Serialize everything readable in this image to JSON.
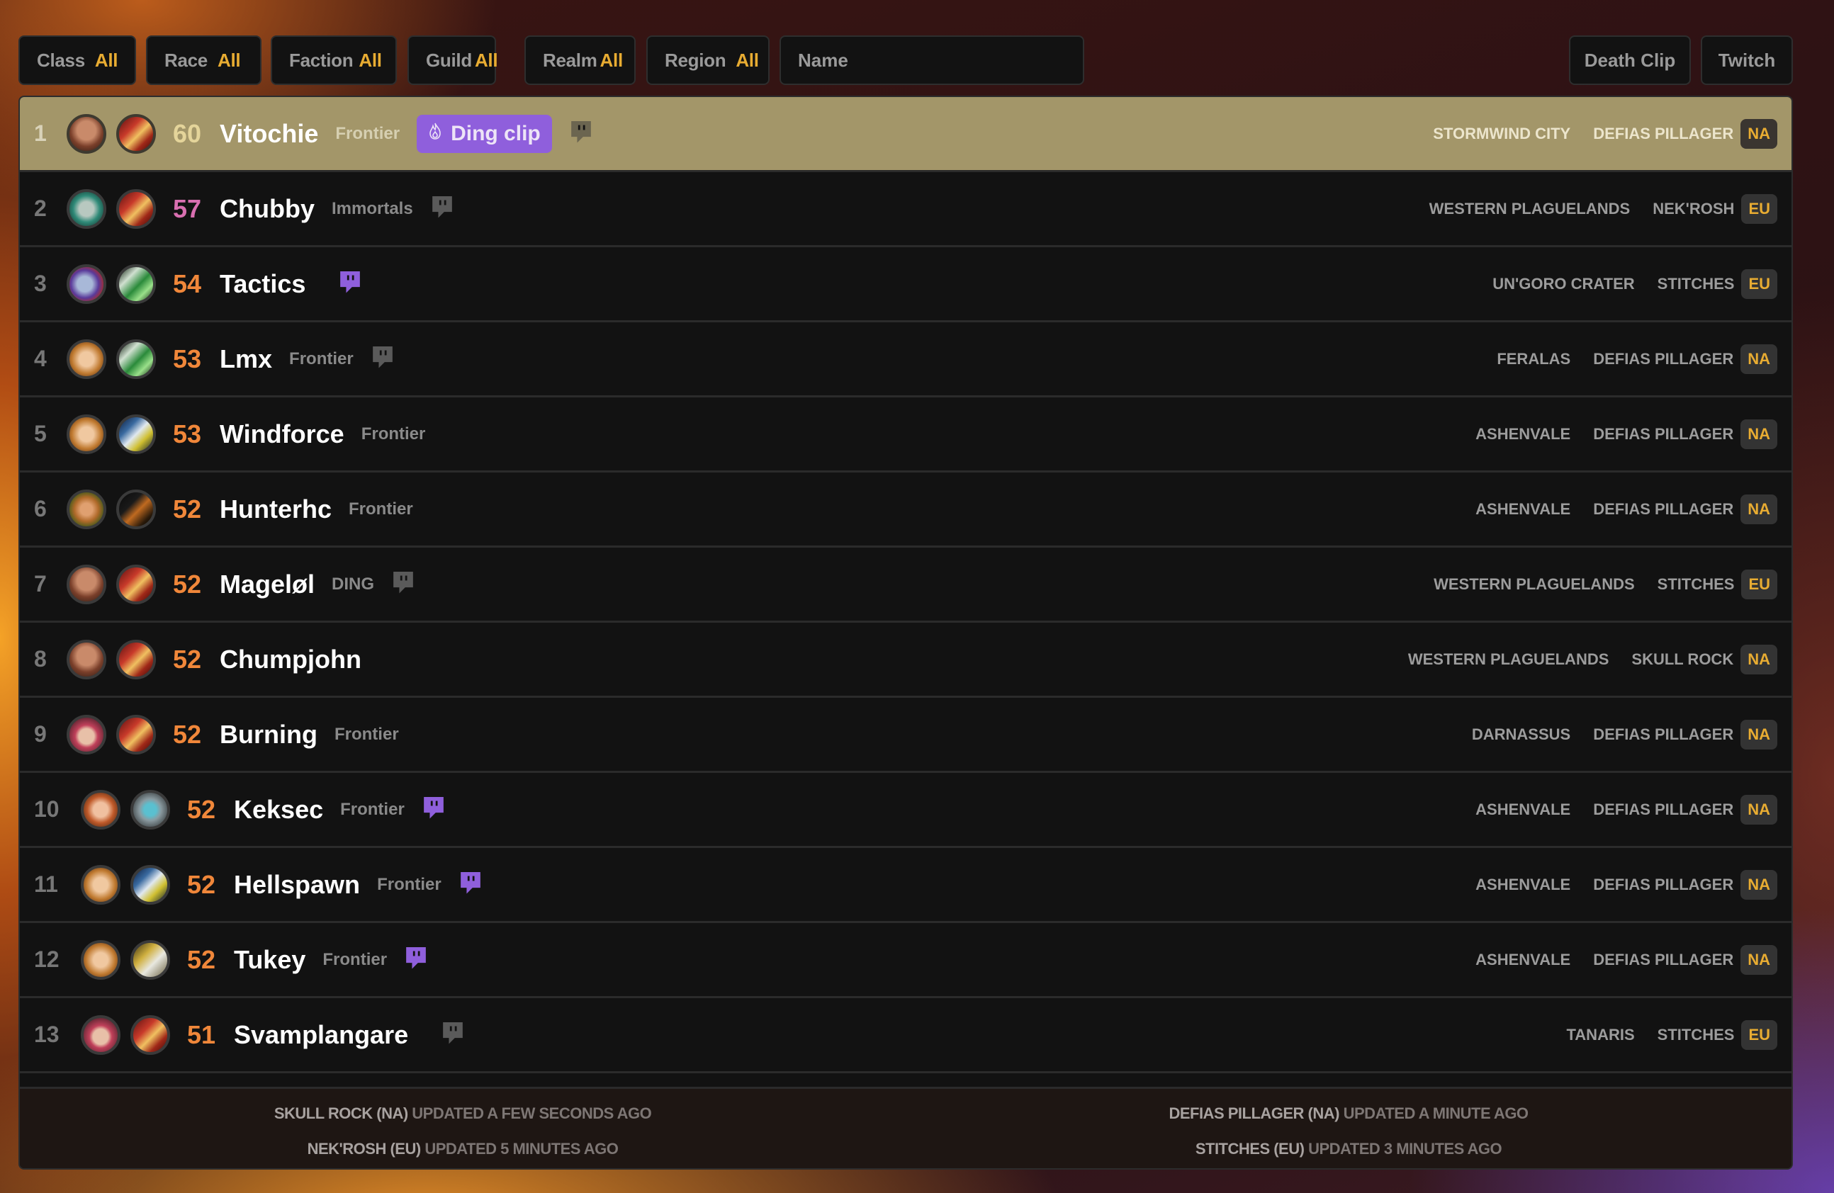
{
  "filters": [
    {
      "label": "Class",
      "value": "All"
    },
    {
      "label": "Race",
      "value": "All"
    },
    {
      "label": "Faction",
      "value": "All"
    },
    {
      "label": "Guild",
      "value": "All"
    },
    {
      "label": "Realm",
      "value": "All"
    },
    {
      "label": "Region",
      "value": "All"
    }
  ],
  "search": {
    "placeholder": "Name",
    "value": ""
  },
  "toolbar": {
    "death_clip_label": "Death Clip",
    "twitch_label": "Twitch"
  },
  "colors": {
    "accent": "#e8ac32",
    "highlight_row": "#a39669",
    "twitch_active": "#8f5fdc",
    "twitch_inactive": "#5a5a5a",
    "level_orange": "#f0873a",
    "level_pink": "#d86fb0",
    "level_gold": "#e4d49a"
  },
  "players": [
    {
      "rank": "1",
      "level": "60",
      "level_color": "level_gold",
      "name": "Vitochie",
      "guild": "Frontier",
      "ding_clip": "Ding clip",
      "twitch": "inactive",
      "zone": "STORMWIND CITY",
      "realm": "DEFIAS PILLAGER",
      "region": "NA",
      "race_icon": "gnome-male-portrait-icon",
      "class_icon": "mage-class-icon"
    },
    {
      "rank": "2",
      "level": "57",
      "level_color": "level_pink",
      "name": "Chubby",
      "guild": "Immortals",
      "twitch": "inactive",
      "zone": "WESTERN PLAGUELANDS",
      "realm": "NEK'ROSH",
      "region": "EU",
      "race_icon": "undead-female-portrait-icon",
      "class_icon": "mage-class-icon"
    },
    {
      "rank": "3",
      "level": "54",
      "level_color": "level_orange",
      "name": "Tactics",
      "guild": "",
      "twitch": "active",
      "zone": "UN'GORO CRATER",
      "realm": "STITCHES",
      "region": "EU",
      "race_icon": "troll-male-portrait-icon",
      "class_icon": "hunter-class-icon"
    },
    {
      "rank": "4",
      "level": "53",
      "level_color": "level_orange",
      "name": "Lmx",
      "guild": "Frontier",
      "twitch": "inactive",
      "zone": "FERALAS",
      "realm": "DEFIAS PILLAGER",
      "region": "NA",
      "race_icon": "human-female-portrait-icon",
      "class_icon": "hunter-class-icon"
    },
    {
      "rank": "5",
      "level": "53",
      "level_color": "level_orange",
      "name": "Windforce",
      "guild": "Frontier",
      "twitch": "none",
      "zone": "ASHENVALE",
      "realm": "DEFIAS PILLAGER",
      "region": "NA",
      "race_icon": "human-female-portrait-icon",
      "class_icon": "warrior-class-icon"
    },
    {
      "rank": "6",
      "level": "52",
      "level_color": "level_orange",
      "name": "Hunterhc",
      "guild": "Frontier",
      "twitch": "none",
      "zone": "ASHENVALE",
      "realm": "DEFIAS PILLAGER",
      "region": "NA",
      "race_icon": "dwarf-male-portrait-icon",
      "class_icon": "rogue-class-icon"
    },
    {
      "rank": "7",
      "level": "52",
      "level_color": "level_orange",
      "name": "Mageløl",
      "guild": "DING",
      "twitch": "inactive",
      "zone": "WESTERN PLAGUELANDS",
      "realm": "STITCHES",
      "region": "EU",
      "race_icon": "gnome-male-portrait-icon",
      "class_icon": "mage-class-icon"
    },
    {
      "rank": "8",
      "level": "52",
      "level_color": "level_orange",
      "name": "Chumpjohn",
      "guild": "",
      "twitch": "none",
      "zone": "WESTERN PLAGUELANDS",
      "realm": "SKULL ROCK",
      "region": "NA",
      "race_icon": "gnome-male-portrait-icon",
      "class_icon": "mage-class-icon"
    },
    {
      "rank": "9",
      "level": "52",
      "level_color": "level_orange",
      "name": "Burning",
      "guild": "Frontier",
      "twitch": "none",
      "zone": "DARNASSUS",
      "realm": "DEFIAS PILLAGER",
      "region": "NA",
      "race_icon": "gnome-female-portrait-icon",
      "class_icon": "mage-class-icon"
    },
    {
      "rank": "10",
      "level": "52",
      "level_color": "level_orange",
      "name": "Keksec",
      "guild": "Frontier",
      "twitch": "active",
      "zone": "ASHENVALE",
      "realm": "DEFIAS PILLAGER",
      "region": "NA",
      "race_icon": "dwarf-female-portrait-icon",
      "class_icon": "paladin-class-icon"
    },
    {
      "rank": "11",
      "level": "52",
      "level_color": "level_orange",
      "name": "Hellspawn",
      "guild": "Frontier",
      "twitch": "active",
      "zone": "ASHENVALE",
      "realm": "DEFIAS PILLAGER",
      "region": "NA",
      "race_icon": "human-female-portrait-icon",
      "class_icon": "warrior-class-icon"
    },
    {
      "rank": "12",
      "level": "52",
      "level_color": "level_orange",
      "name": "Tukey",
      "guild": "Frontier",
      "twitch": "active",
      "zone": "ASHENVALE",
      "realm": "DEFIAS PILLAGER",
      "region": "NA",
      "race_icon": "human-female-portrait-icon",
      "class_icon": "paladin-hammer-class-icon"
    },
    {
      "rank": "13",
      "level": "51",
      "level_color": "level_orange",
      "name": "Svamplangare",
      "guild": "",
      "twitch": "inactive",
      "zone": "TANARIS",
      "realm": "STITCHES",
      "region": "EU",
      "race_icon": "gnome-female-portrait-icon",
      "class_icon": "mage-class-icon"
    }
  ],
  "footer": [
    {
      "server": "SKULL ROCK (NA)",
      "status": "UPDATED A FEW SECONDS AGO"
    },
    {
      "server": "DEFIAS PILLAGER (NA)",
      "status": "UPDATED A MINUTE AGO"
    },
    {
      "server": "NEK'ROSH (EU)",
      "status": "UPDATED 5 MINUTES AGO"
    },
    {
      "server": "STITCHES (EU)",
      "status": "UPDATED 3 MINUTES AGO"
    }
  ]
}
